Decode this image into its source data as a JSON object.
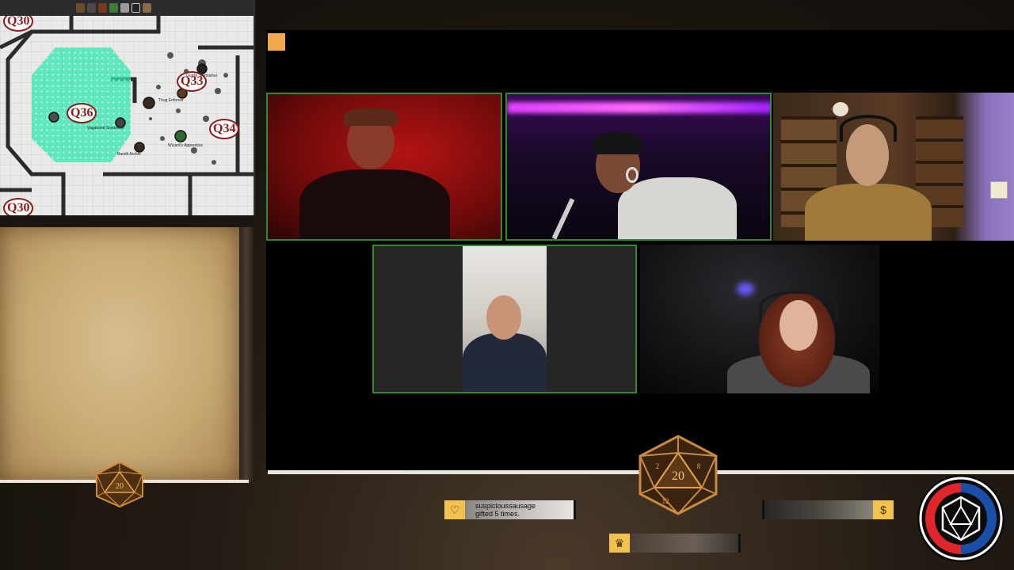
{
  "map": {
    "room_labels": [
      "Q30",
      "Q33",
      "Q36",
      "Q34",
      "Q30"
    ],
    "token_labels": [
      "Vagabond Scoundrel",
      "Wizard's Apprentice",
      "Bandit Archer",
      "Goblin Skirmisher",
      "Thug Enforcer"
    ]
  },
  "cams": {
    "count": 5
  },
  "alerts": {
    "sub_user": "suspicioussausage",
    "sub_message": "gifted 5 times.",
    "donation_icon": "$",
    "crown_icon": "♛",
    "heart_icon": "♡"
  },
  "logo": {
    "left_color": "#e0262b",
    "right_color": "#1a4fa8",
    "ring_color": "#ffffff"
  },
  "colors": {
    "map_fog": "#32e6b0",
    "alert_gold": "#f2c14f",
    "cam_border": "#2e8b2e"
  }
}
